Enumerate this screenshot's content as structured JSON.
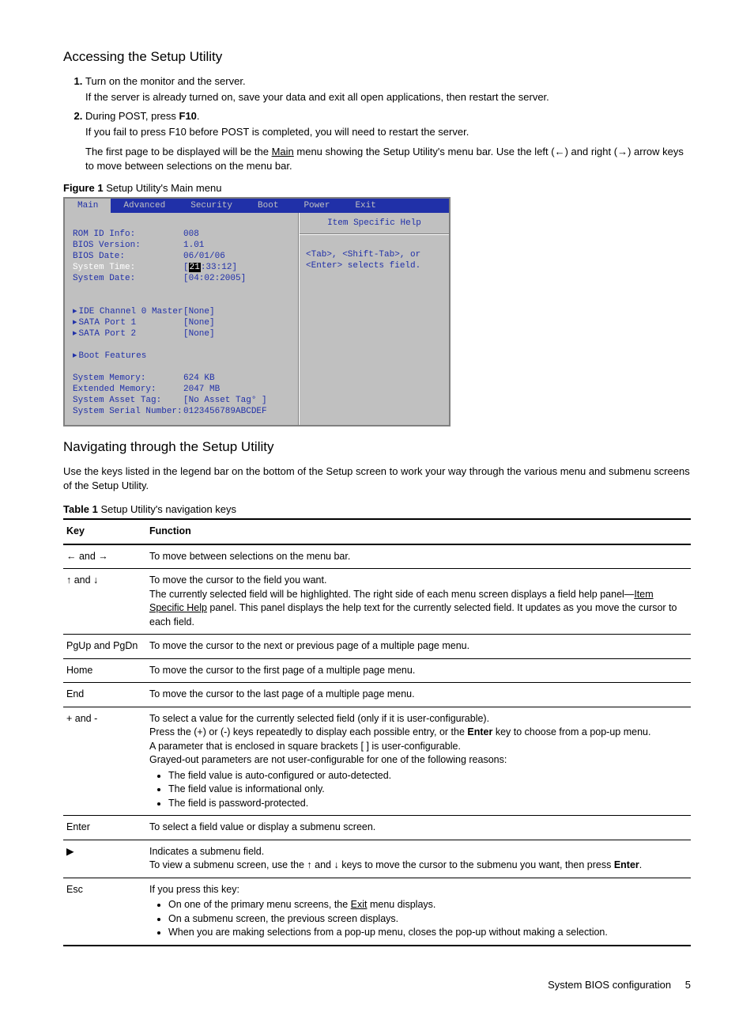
{
  "heading1": "Accessing the Setup Utility",
  "steps": {
    "s1": "Turn on the monitor and the server.",
    "s1b": "If the server is already turned on, save your data and exit all open applications, then restart the server.",
    "s2a": "During POST, press ",
    "s2b": "F10",
    "s2c": ".",
    "s2sub1": "If you fail to press F10 before POST is completed, you will need to restart the server.",
    "s2sub2a": "The first page to be displayed will be the ",
    "s2sub2b": "Main",
    "s2sub2c": " menu showing the Setup Utility's menu bar. Use the left (←) and right (→) arrow keys to move between selections on the menu bar."
  },
  "figure1": {
    "label": "Figure 1",
    "caption": " Setup Utility's Main menu"
  },
  "bios": {
    "tabs": [
      "Main",
      "Advanced",
      "Security",
      "Boot",
      "Power",
      "Exit"
    ],
    "rows1": [
      {
        "label": "ROM ID Info:",
        "val": "008"
      },
      {
        "label": "BIOS Version:",
        "val": " 1.01"
      },
      {
        "label": "BIOS Date:",
        "val": "06/01/06"
      }
    ],
    "systime_label": "System Time:",
    "systime_val_pre": "[",
    "systime_val_sel": "21",
    "systime_val_post": ":33:12]",
    "sysdate_label": "System Date:",
    "sysdate_val": "[04:02:2005]",
    "rows2": [
      {
        "label": "IDE Channel 0 Master",
        "val": "[None]",
        "tri": true
      },
      {
        "label": "SATA Port 1",
        "val": "[None]",
        "tri": true
      },
      {
        "label": "SATA Port 2",
        "val": "[None]",
        "tri": true
      }
    ],
    "bootfeat": "Boot Features",
    "rows3": [
      {
        "label": "System Memory:",
        "val": "624 KB"
      },
      {
        "label": "Extended Memory:",
        "val": "2047 MB"
      },
      {
        "label": "System Asset Tag:",
        "val": "[No Asset Tag°  ]"
      },
      {
        "label": "System Serial Number:",
        "val": "0123456789ABCDEF"
      }
    ],
    "help_title": "Item Specific Help",
    "help_body": "<Tab>, <Shift-Tab>, or <Enter> selects field."
  },
  "heading2": "Navigating through the Setup Utility",
  "nav_intro": "Use the keys listed in the legend bar on the bottom of the Setup screen to work your way through the various menu and submenu screens of the Setup Utility.",
  "table1": {
    "label": "Table 1",
    "caption": " Setup Utility's navigation keys"
  },
  "th_key": "Key",
  "th_func": "Function",
  "rows": {
    "r1k": "← and →",
    "r1f": "To move between selections on the menu bar.",
    "r2k": "↑ and ↓",
    "r2f1": "To move the cursor to the field you want.",
    "r2f2a": "The currently selected field will be highlighted. The right side of each menu screen displays a field help panel—",
    "r2f2b": "Item Specific Help",
    "r2f2c": " panel. This panel displays the help text for the currently selected field. It updates as you move the cursor to each field.",
    "r3k": "PgUp and PgDn",
    "r3f": "To move the cursor to the next or previous page of a multiple page menu.",
    "r4k": "Home",
    "r4f": "To move the cursor to the first page of a multiple page menu.",
    "r5k": "End",
    "r5f": "To move the cursor to the last page of a multiple page menu.",
    "r6k": "+ and -",
    "r6f1": "To select a value for the currently selected field (only if it is user-configurable).",
    "r6f2a": "Press the (+) or (-) keys repeatedly to display each possible entry, or the ",
    "r6f2b": "Enter",
    "r6f2c": " key to choose from a pop-up menu.",
    "r6f3": "A parameter that is enclosed in square brackets [ ] is user-configurable.",
    "r6f4": "Grayed-out parameters are not user-configurable for one of the following reasons:",
    "r6b1": "The field value is auto-configured or auto-detected.",
    "r6b2": "The field value is informational only.",
    "r6b3": "The field is password-protected.",
    "r7k": "Enter",
    "r7f": "To select a field value or display a submenu screen.",
    "r8k": "▶",
    "r8f1": "Indicates a submenu field.",
    "r8f2a": "To view a submenu screen, use the ↑ and ↓ keys to move the cursor to the submenu you want, then press ",
    "r8f2b": "Enter",
    "r8f2c": ".",
    "r9k": "Esc",
    "r9f1": "If you press this key:",
    "r9b1a": "On one of the primary menu screens, the ",
    "r9b1b": "Exit",
    "r9b1c": " menu displays.",
    "r9b2": "On a submenu screen, the previous screen displays.",
    "r9b3": "When you are making selections from a pop-up menu, closes the pop-up without making a selection."
  },
  "footer_text": "System BIOS configuration",
  "footer_page": "5"
}
